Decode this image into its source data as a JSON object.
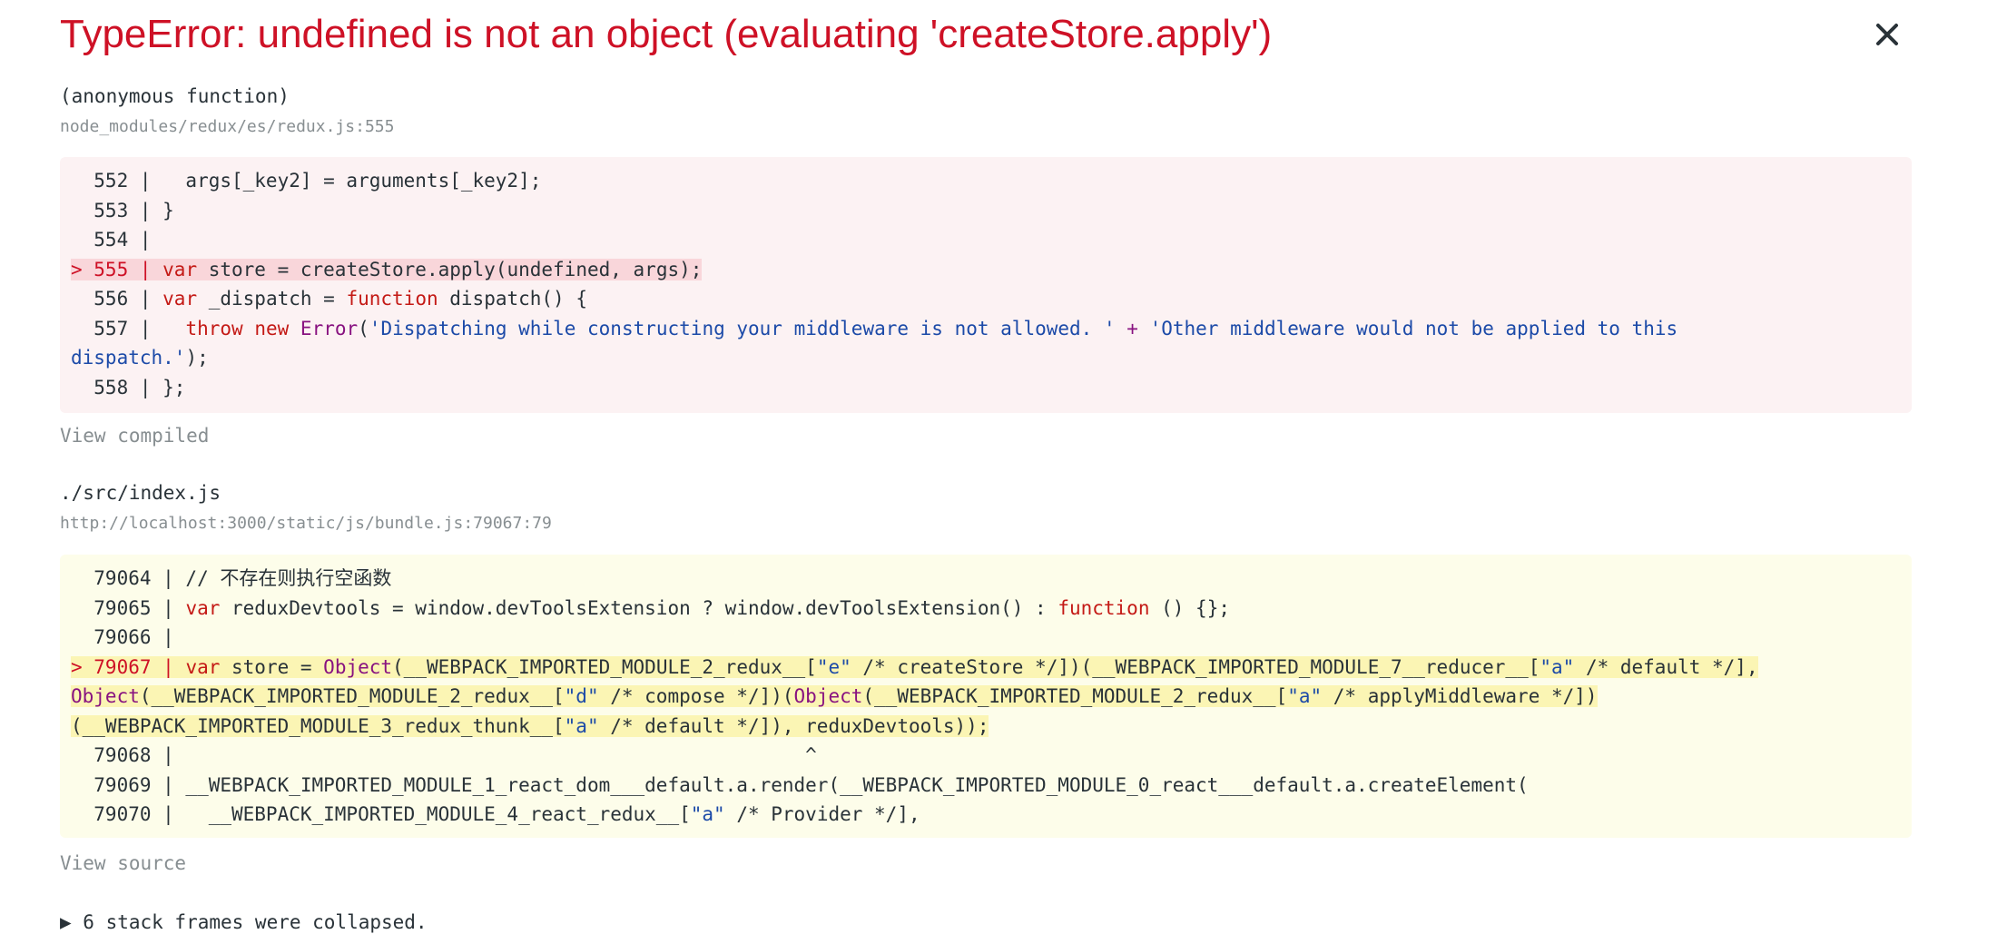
{
  "error": {
    "title": "TypeError: undefined is not an object (evaluating 'createStore.apply')",
    "close_label": "×"
  },
  "frames": [
    {
      "function": "(anonymous function)",
      "location": "node_modules/redux/es/redux.js:555",
      "lines": {
        "l552": "  552 |   args[_key2] = arguments[_key2];",
        "l553": "  553 | }",
        "l554": "  554 |",
        "l555_prefix": "> 555 | ",
        "l555_kw": "var",
        "l555_rest": " store = createStore.apply(undefined, args);",
        "l556_prefix": "  556 | ",
        "l556_kw": "var",
        "l556_mid": " _dispatch = ",
        "l556_fn": "function",
        "l556_rest": " dispatch() {",
        "l557_prefix": "  557 |   ",
        "l557_throw": "throw",
        "l557_new": "new",
        "l557_err": "Error",
        "l557_str1": "'Dispatching while constructing your middleware is not allowed. '",
        "l557_plus": "+",
        "l557_str2a": "'Other middleware would not be applied to this",
        "l557_str2b": "dispatch.'",
        "l557_end": ");",
        "l558": "  558 | };"
      },
      "view_label": "View compiled"
    },
    {
      "function": "./src/index.js",
      "location": "http://localhost:3000/static/js/bundle.js:79067:79",
      "lines": {
        "l79064": "  79064 | // 不存在则执行空函数",
        "l79065_prefix": "  79065 | ",
        "l79065_kw": "var",
        "l79065_a": " reduxDevtools = window.devToolsExtension ? window.devToolsExtension() : ",
        "l79065_fn": "function",
        "l79065_b": " () {};",
        "l79066": "  79066 |",
        "l79067_prefix": "> 79067 | ",
        "l79067_kw": "var",
        "l79067_a": " store = ",
        "l79067_obj1": "Object",
        "l79067_b": "(__WEBPACK_IMPORTED_MODULE_2_redux__[",
        "l79067_s1": "\"e\"",
        "l79067_c": " /* createStore */])(__WEBPACK_IMPORTED_MODULE_7__reducer__[",
        "l79067_s2": "\"a\"",
        "l79067_d": " /* default */],",
        "l79067_obj2": "Object",
        "l79067_e": "(__WEBPACK_IMPORTED_MODULE_2_redux__[",
        "l79067_s3": "\"d\"",
        "l79067_f": " /* compose */])(",
        "l79067_obj3": "Object",
        "l79067_g": "(__WEBPACK_IMPORTED_MODULE_2_redux__[",
        "l79067_s4": "\"a\"",
        "l79067_h": " /* applyMiddleware */])",
        "l79067_i": "(__WEBPACK_IMPORTED_MODULE_3_redux_thunk__[",
        "l79067_s5": "\"a\"",
        "l79067_j": " /* default */]), reduxDevtools));",
        "l79068": "  79068 |                                                       ^",
        "l79069": "  79069 | __WEBPACK_IMPORTED_MODULE_1_react_dom___default.a.render(__WEBPACK_IMPORTED_MODULE_0_react___default.a.createElement(",
        "l79070_a": "  79070 |   __WEBPACK_IMPORTED_MODULE_4_react_redux__[",
        "l79070_s": "\"a\"",
        "l79070_b": " /* Provider */],"
      },
      "view_label": "View source"
    }
  ],
  "collapsed_label": "▶ 6 stack frames were collapsed."
}
